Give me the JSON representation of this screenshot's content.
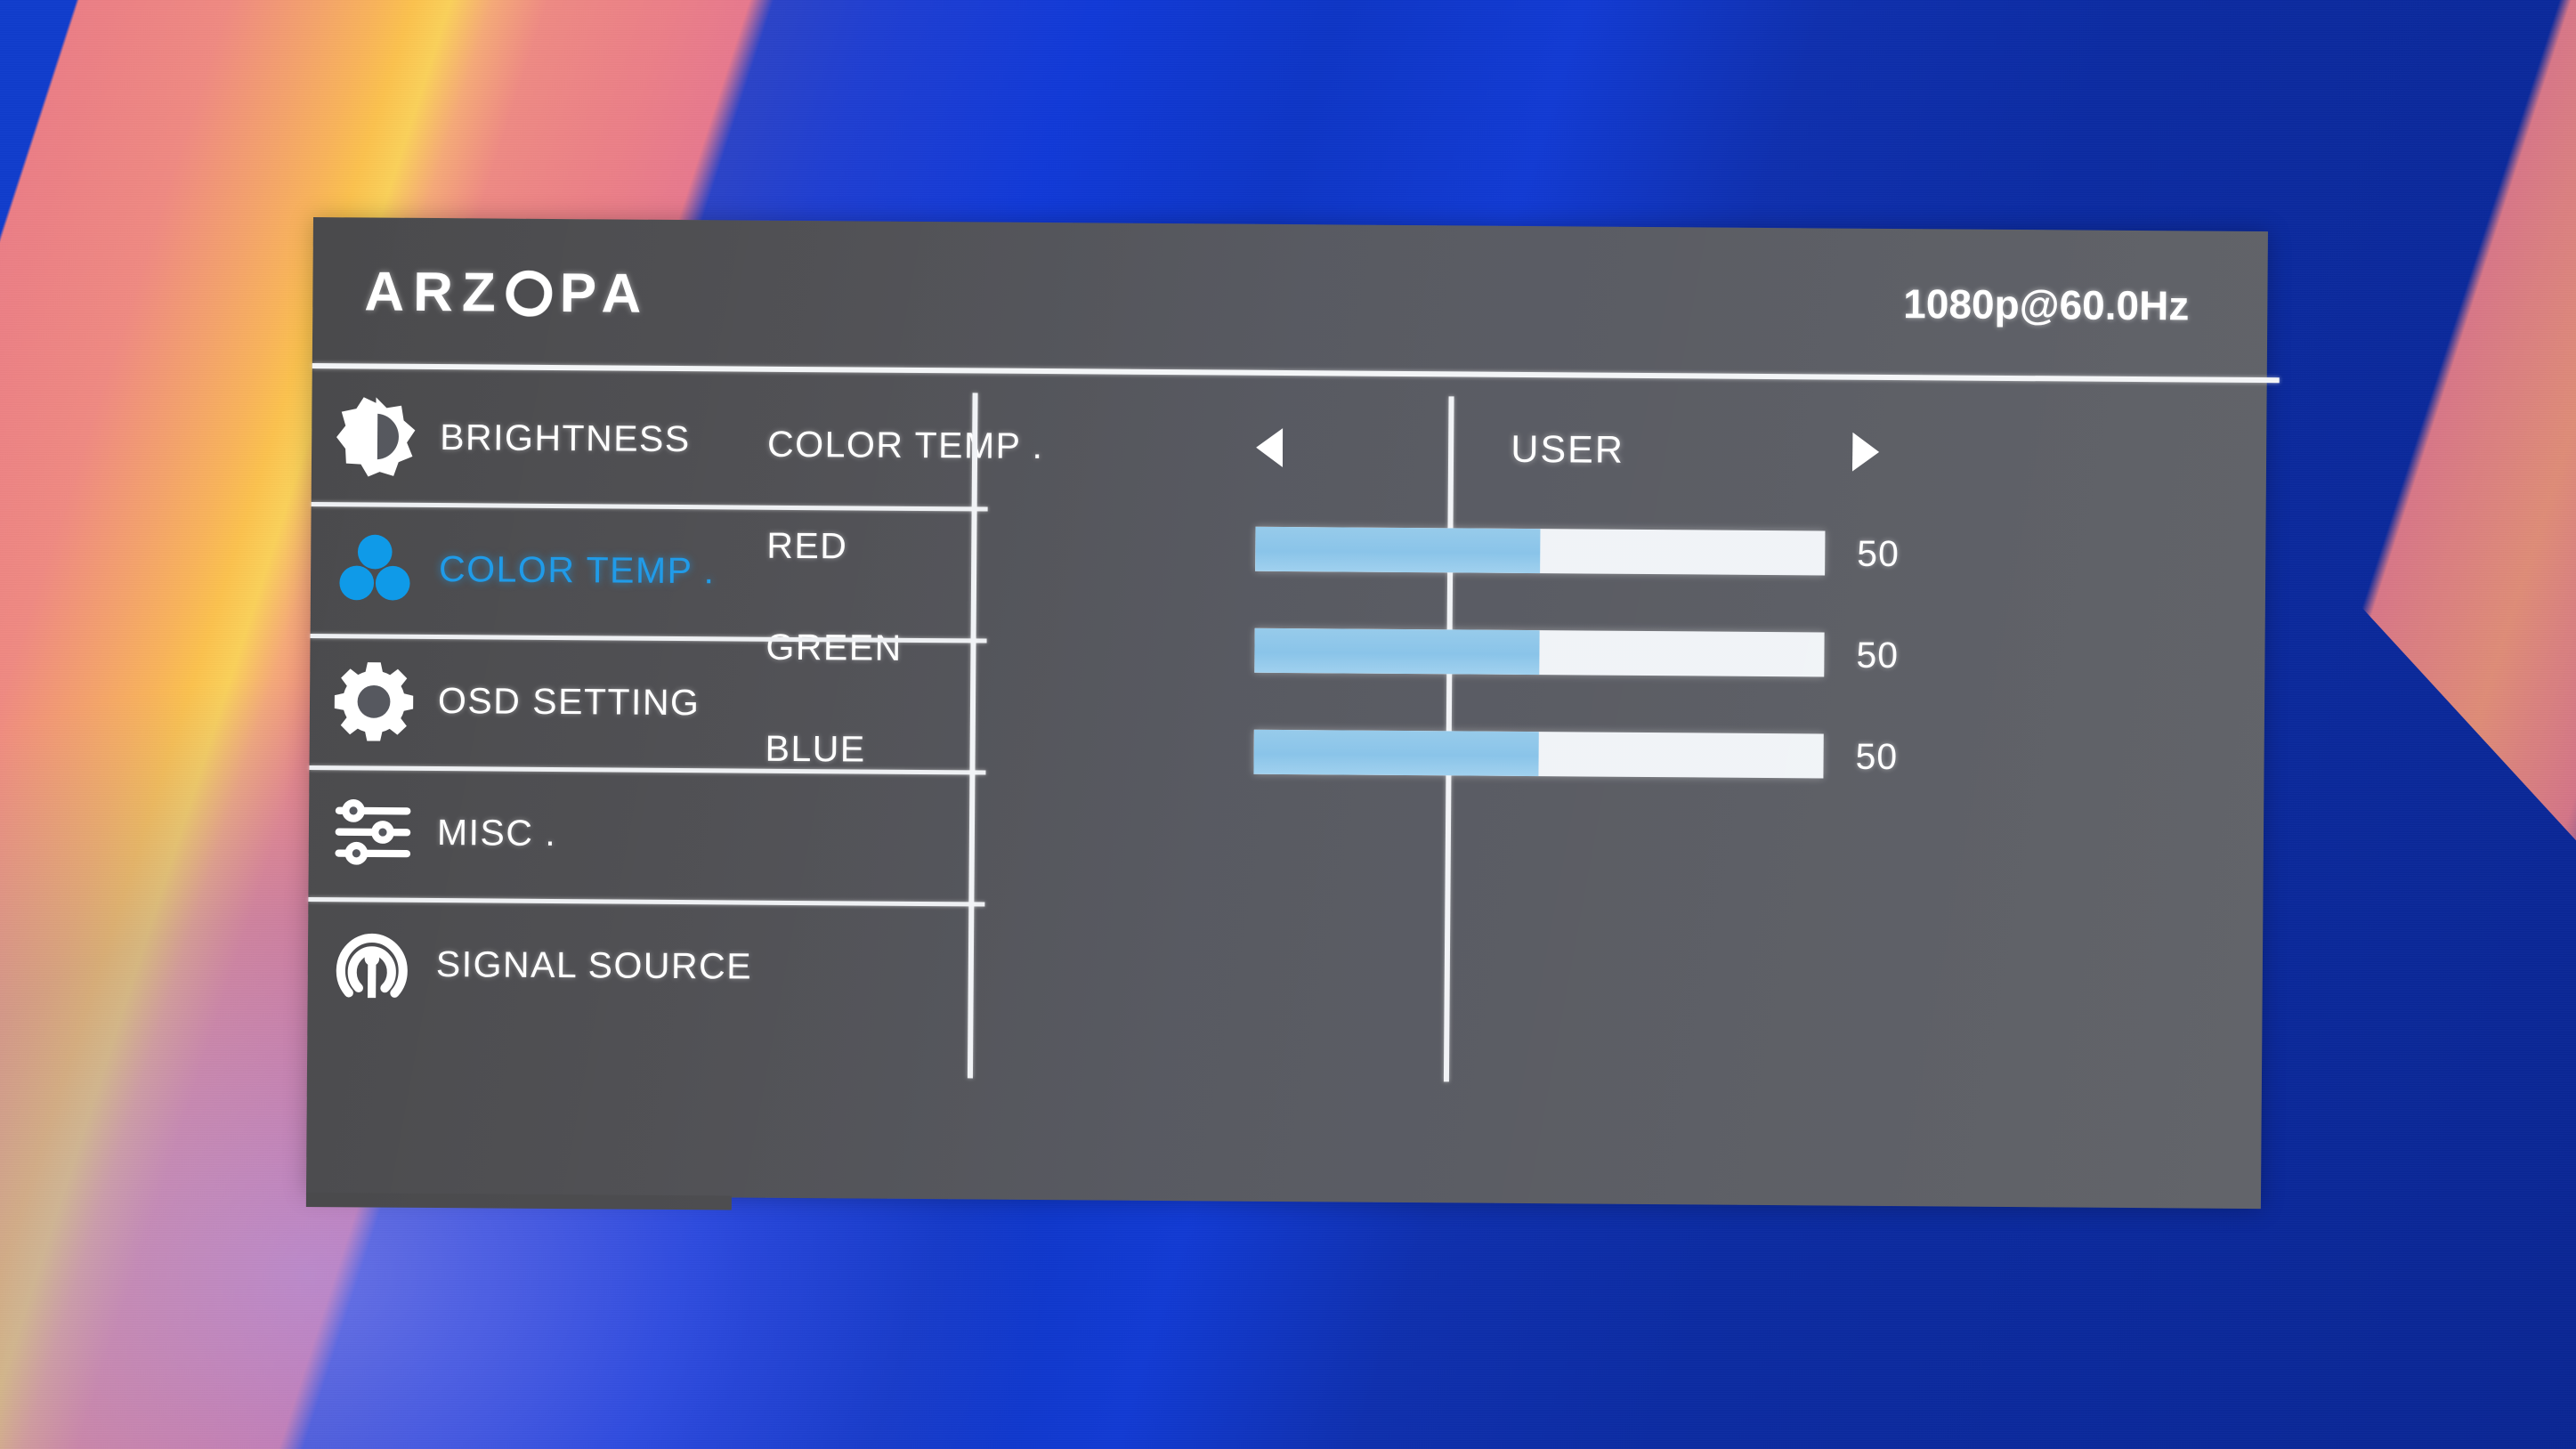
{
  "background": {
    "colors": {
      "blue": "#0d3ccd",
      "deep_blue": "#0a2694",
      "pink": "#ec7e86",
      "orange": "#f9b25c",
      "yellow": "#fcc24e"
    }
  },
  "osd": {
    "header": {
      "brand_prefix": "ARZ",
      "brand_suffix": "PA",
      "brand_full": "ARZOPA",
      "resolution": "1080p@60.0Hz"
    },
    "accent_color": "#1e9ae8",
    "slider_fill_color": "#8cc6e8",
    "slider_track_color": "#f0f3f7",
    "panel_color": "#53555d",
    "sidebar": {
      "items": [
        {
          "label": "BRIGHTNESS",
          "icon": "brightness-icon",
          "active": false
        },
        {
          "label": "COLOR TEMP .",
          "icon": "color-temp-icon",
          "active": true
        },
        {
          "label": "OSD SETTING",
          "icon": "gear-icon",
          "active": false
        },
        {
          "label": "MISC .",
          "icon": "sliders-icon",
          "active": false
        },
        {
          "label": "SIGNAL SOURCE",
          "icon": "signal-source-icon",
          "active": false
        }
      ]
    },
    "options": [
      {
        "name": "COLOR TEMP .",
        "type": "selector",
        "value": "USER"
      },
      {
        "name": "RED",
        "type": "slider",
        "value": "50",
        "percent": 50
      },
      {
        "name": "GREEN",
        "type": "slider",
        "value": "50",
        "percent": 50
      },
      {
        "name": "BLUE",
        "type": "slider",
        "value": "50",
        "percent": 50
      }
    ],
    "selector": {
      "left_arrow": "triangle-left-icon",
      "right_arrow": "triangle-right-icon"
    }
  }
}
